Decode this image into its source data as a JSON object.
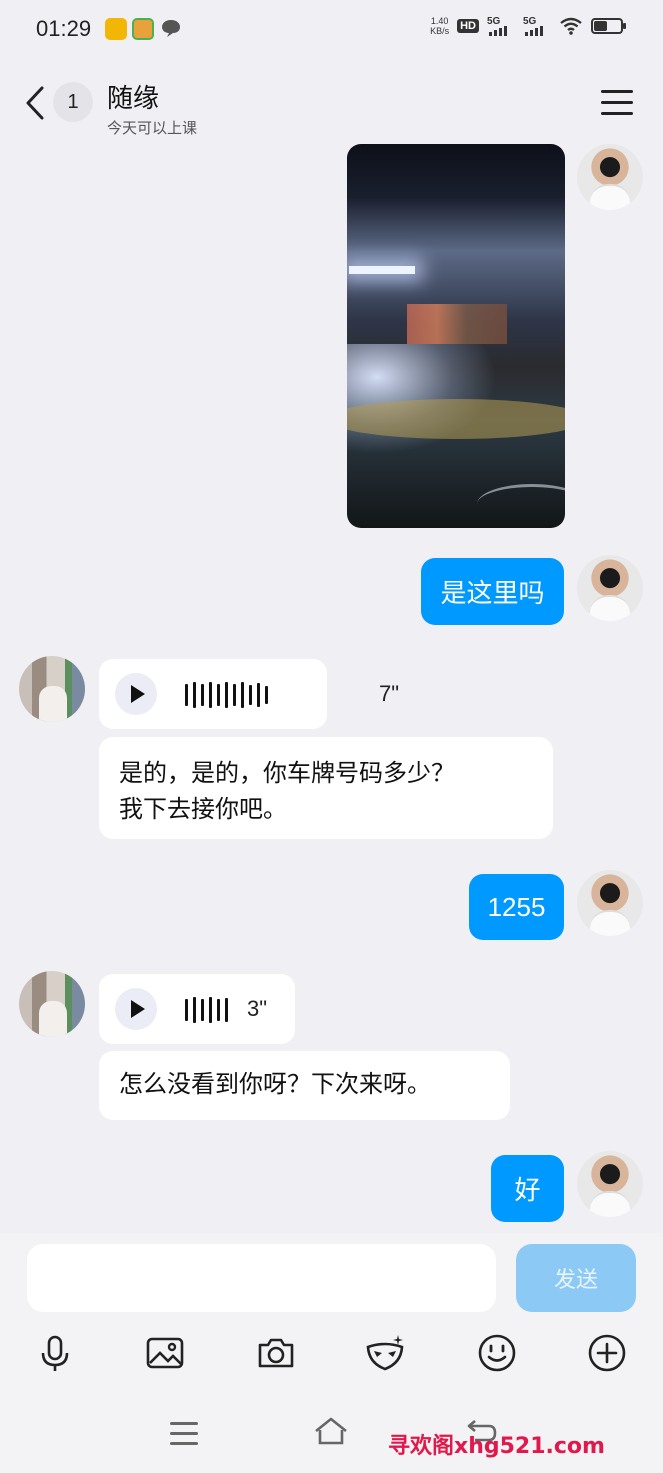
{
  "status_bar": {
    "time": "01:29",
    "net_speed_top": "1.40",
    "net_speed_unit": "KB/s",
    "hd_label": "HD",
    "signal1": "5G",
    "signal2": "5G",
    "battery_level": 0.55
  },
  "header": {
    "unread_count": "1",
    "contact_name": "随缘",
    "contact_status": "今天可以上课"
  },
  "messages": [
    {
      "from": "me",
      "type": "image"
    },
    {
      "from": "me",
      "type": "text",
      "text": "是这里吗"
    },
    {
      "from": "her",
      "type": "voice",
      "duration": "7\""
    },
    {
      "from": "her",
      "type": "text",
      "lines": [
        "是的，是的，你车牌号码多少？",
        "我下去接你吧。"
      ]
    },
    {
      "from": "me",
      "type": "text",
      "text": "1255"
    },
    {
      "from": "her",
      "type": "voice",
      "duration": "3\""
    },
    {
      "from": "her",
      "type": "text",
      "text": "怎么没看到你呀？下次来呀。"
    },
    {
      "from": "me",
      "type": "text",
      "text": "好"
    }
  ],
  "input": {
    "value": "",
    "placeholder": "",
    "send_label": "发送"
  },
  "toolbar": {
    "icons": [
      "microphone-icon",
      "image-icon",
      "camera-icon",
      "mask-icon",
      "emoji-icon",
      "plus-icon"
    ]
  },
  "watermark": "寻欢阁xhg521.com",
  "colors": {
    "bubble_me": "#0099ff",
    "bubble_her": "#ffffff",
    "send_disabled": "#8cc9f5",
    "background": "#f0f0f4",
    "watermark": "#e0184b"
  }
}
